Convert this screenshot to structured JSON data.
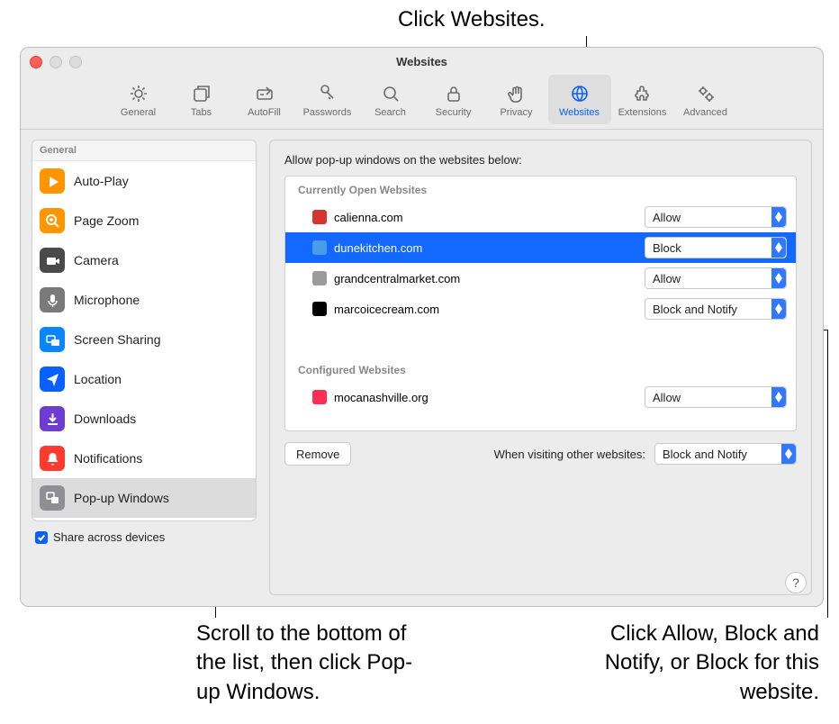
{
  "callouts": {
    "top": "Click Websites.",
    "bottomLeft": "Scroll to the bottom of the list, then click Pop-up Windows.",
    "bottomRight": "Click Allow, Block and Notify, or Block for this website."
  },
  "window": {
    "title": "Websites"
  },
  "toolbar": [
    {
      "id": "general",
      "label": "General",
      "icon": "gear",
      "selected": false
    },
    {
      "id": "tabs",
      "label": "Tabs",
      "icon": "tabs",
      "selected": false
    },
    {
      "id": "autofill",
      "label": "AutoFill",
      "icon": "autofill",
      "selected": false
    },
    {
      "id": "passwords",
      "label": "Passwords",
      "icon": "key",
      "selected": false
    },
    {
      "id": "search",
      "label": "Search",
      "icon": "search",
      "selected": false
    },
    {
      "id": "security",
      "label": "Security",
      "icon": "lock",
      "selected": false
    },
    {
      "id": "privacy",
      "label": "Privacy",
      "icon": "hand",
      "selected": false
    },
    {
      "id": "websites",
      "label": "Websites",
      "icon": "globe",
      "selected": true
    },
    {
      "id": "extensions",
      "label": "Extensions",
      "icon": "puzzle",
      "selected": false
    },
    {
      "id": "advanced",
      "label": "Advanced",
      "icon": "gears",
      "selected": false
    }
  ],
  "sidebar": {
    "header": "General",
    "items": [
      {
        "id": "auto-play",
        "label": "Auto-Play",
        "icon": "play",
        "color": "#ff9500"
      },
      {
        "id": "page-zoom",
        "label": "Page Zoom",
        "icon": "zoom",
        "color": "#ff9500"
      },
      {
        "id": "camera",
        "label": "Camera",
        "icon": "camera",
        "color": "#4a4a4a"
      },
      {
        "id": "microphone",
        "label": "Microphone",
        "icon": "mic",
        "color": "#7a7a7a"
      },
      {
        "id": "screen-sharing",
        "label": "Screen Sharing",
        "icon": "screens",
        "color": "#0a84ff"
      },
      {
        "id": "location",
        "label": "Location",
        "icon": "location",
        "color": "#0a60ff"
      },
      {
        "id": "downloads",
        "label": "Downloads",
        "icon": "download",
        "color": "#6d3cd1"
      },
      {
        "id": "notifications",
        "label": "Notifications",
        "icon": "bell",
        "color": "#ff3b30"
      },
      {
        "id": "popup",
        "label": "Pop-up Windows",
        "icon": "popups",
        "color": "#8e8e93",
        "selected": true
      }
    ],
    "share": {
      "checked": true,
      "label": "Share across devices"
    }
  },
  "main": {
    "title": "Allow pop-up windows on the websites below:",
    "openHeader": "Currently Open Websites",
    "confHeader": "Configured Websites",
    "openSites": [
      {
        "site": "calienna.com",
        "value": "Allow",
        "selected": false,
        "favcolor": "#d6342f"
      },
      {
        "site": "dunekitchen.com",
        "value": "Block",
        "selected": true,
        "favcolor": "#4a9be8"
      },
      {
        "site": "grandcentralmarket.com",
        "value": "Allow",
        "selected": false,
        "favcolor": "#9b9b9b"
      },
      {
        "site": "marcoicecream.com",
        "value": "Block and Notify",
        "selected": false,
        "favcolor": "#000000"
      }
    ],
    "confSites": [
      {
        "site": "mocanashville.org",
        "value": "Allow",
        "selected": false,
        "favcolor": "#ff2d55"
      }
    ],
    "removeLabel": "Remove",
    "otherLabel": "When visiting other websites:",
    "otherValue": "Block and Notify",
    "helpLabel": "?"
  }
}
